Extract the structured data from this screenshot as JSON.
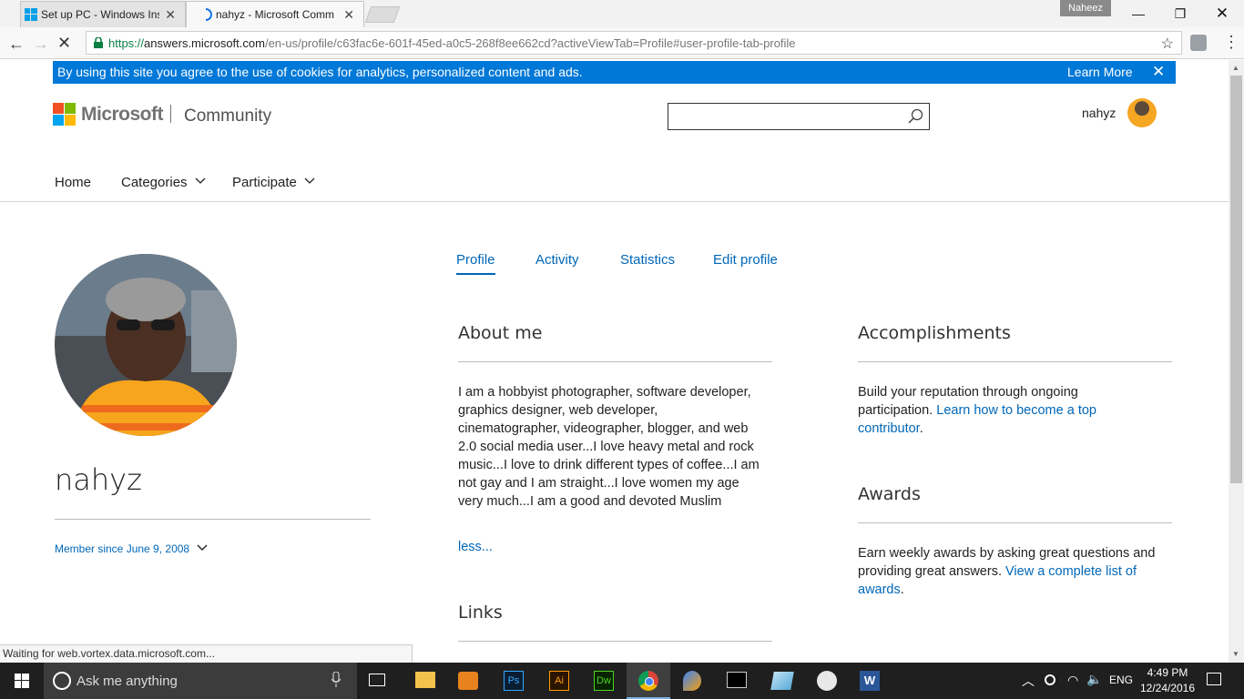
{
  "browser": {
    "tabs": [
      {
        "label": "Set up PC - Windows Insi",
        "active": false
      },
      {
        "label": "nahyz - Microsoft Comm",
        "active": true
      }
    ],
    "profile_badge": "Naheez",
    "url": {
      "scheme": "https://",
      "host": "answers.microsoft.com",
      "path": "/en-us/profile/c63fac6e-601f-45ed-a0c5-268f8ee662cd?activeViewTab=Profile#user-profile-tab-profile"
    },
    "status_text": "Waiting for web.vortex.data.microsoft.com..."
  },
  "cookie_banner": {
    "text": "By using this site you agree to the use of cookies for analytics, personalized content and ads.",
    "learn_more": "Learn More"
  },
  "header": {
    "brand": "Microsoft",
    "section": "Community",
    "username": "nahyz"
  },
  "nav": {
    "home": "Home",
    "categories": "Categories",
    "participate": "Participate"
  },
  "profile": {
    "display_name": "nahyz",
    "member_since": "Member since June 9, 2008"
  },
  "profile_tabs": [
    "Profile",
    "Activity",
    "Statistics",
    "Edit profile"
  ],
  "about": {
    "heading": "About me",
    "lines": [
      "I am a hobbyist photographer, software developer,",
      "graphics designer, web developer,",
      "cinematographer, videographer, blogger, and web",
      "2.0 social media user...I love heavy metal and rock",
      "music...I love to drink different types of coffee...I am",
      "not gay and I am straight...I love women my age",
      "very much...I am a good and devoted Muslim"
    ],
    "less": "less..."
  },
  "links": {
    "heading": "Links"
  },
  "accomplishments": {
    "heading": "Accomplishments",
    "line1": "Build your reputation through ongoing",
    "line2_prefix": "participation. ",
    "line2_link": "Learn how to become a top",
    "line3_link": "contributor",
    "line3_suffix": "."
  },
  "awards": {
    "heading": "Awards",
    "line1": "Earn weekly awards by asking great questions and",
    "line2_prefix": "providing great answers. ",
    "line2_link": "View a complete list of",
    "line3_link": "awards",
    "line3_suffix": "."
  },
  "taskbar": {
    "search_placeholder": "Ask me anything",
    "language": "ENG",
    "time": "4:49 PM",
    "date": "12/24/2016"
  },
  "colors": {
    "accent_blue": "#0067b8",
    "banner_blue": "#0078d7",
    "taskbar": "#1f1f1f"
  }
}
